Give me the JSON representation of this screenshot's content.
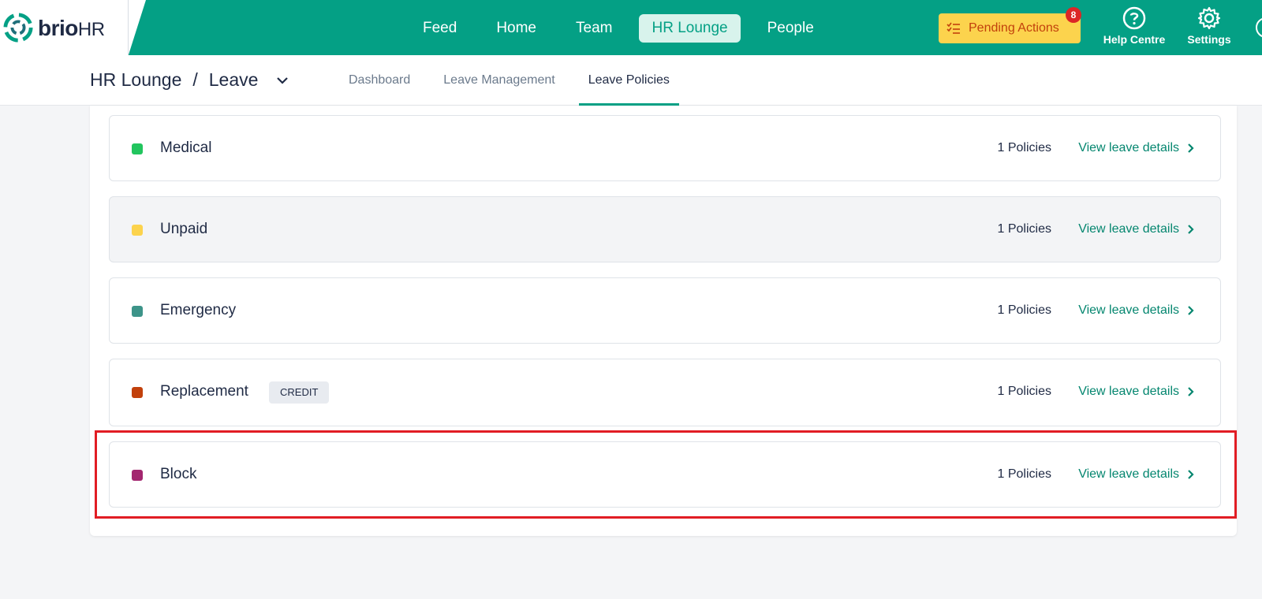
{
  "brand": {
    "name": "brio",
    "suffix": "HR"
  },
  "nav": {
    "items": [
      "Feed",
      "Home",
      "Team",
      "HR Lounge",
      "People"
    ],
    "active": "HR Lounge"
  },
  "pending_actions": {
    "label": "Pending Actions",
    "count": "8"
  },
  "help": {
    "label": "Help Centre"
  },
  "settings": {
    "label": "Settings"
  },
  "breadcrumb": {
    "root": "HR Lounge",
    "separator": "/",
    "current": "Leave"
  },
  "tabs": {
    "items": [
      "Dashboard",
      "Leave Management",
      "Leave Policies"
    ],
    "active": "Leave Policies"
  },
  "leave_types": [
    {
      "name": "Medical",
      "color": "#22c55e",
      "tag": "",
      "count": "1 Policies",
      "link": "View leave details"
    },
    {
      "name": "Unpaid",
      "color": "#fcd34d",
      "tag": "",
      "count": "1 Policies",
      "link": "View leave details"
    },
    {
      "name": "Emergency",
      "color": "#3d9489",
      "tag": "",
      "count": "1 Policies",
      "link": "View leave details"
    },
    {
      "name": "Replacement",
      "color": "#c2410c",
      "tag": "CREDIT",
      "count": "1 Policies",
      "link": "View leave details"
    },
    {
      "name": "Block",
      "color": "#a3266f",
      "tag": "",
      "count": "1 Policies",
      "link": "View leave details"
    }
  ],
  "colors": {
    "brand": "#04a085",
    "highlight": "#e11d24"
  }
}
